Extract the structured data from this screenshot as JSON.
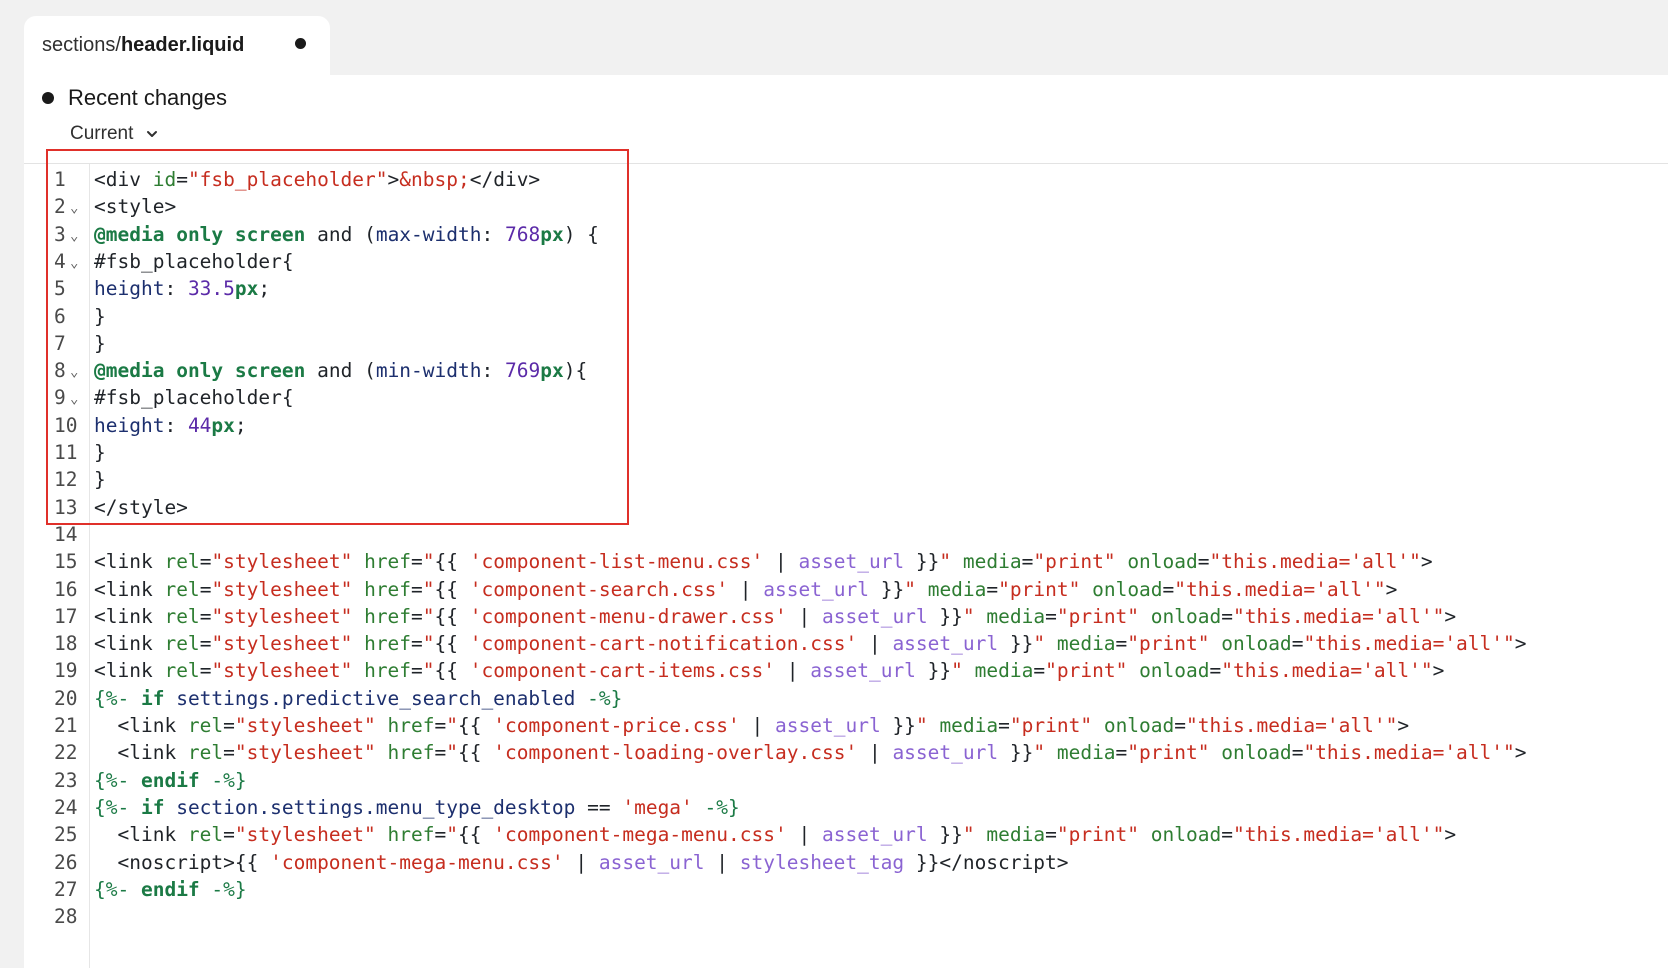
{
  "tab": {
    "path_prefix": "sections/",
    "file_name": "header.liquid"
  },
  "panel": {
    "title": "Recent changes",
    "version": "Current"
  },
  "colors": {
    "highlight": "#e0302a",
    "string": "#c62d1f",
    "keyword": "#1b7a45",
    "number": "#5b2aa8",
    "filter": "#8a63d2"
  },
  "code": {
    "lines": [
      {
        "n": "1",
        "fold": false,
        "tokens": [
          [
            "plain",
            "<div "
          ],
          [
            "attr",
            "id"
          ],
          [
            "plain",
            "="
          ],
          [
            "str",
            "\"fsb_placeholder\""
          ],
          [
            "plain",
            ">"
          ],
          [
            "str",
            "&nbsp;"
          ],
          [
            "plain",
            "</div>"
          ]
        ]
      },
      {
        "n": "2",
        "fold": true,
        "tokens": [
          [
            "plain",
            "<style>"
          ]
        ]
      },
      {
        "n": "3",
        "fold": true,
        "tokens": [
          [
            "kw",
            "@media"
          ],
          [
            "plain",
            " "
          ],
          [
            "kw",
            "only"
          ],
          [
            "plain",
            " "
          ],
          [
            "kw",
            "screen"
          ],
          [
            "plain",
            " and ("
          ],
          [
            "prop",
            "max-width"
          ],
          [
            "plain",
            ": "
          ],
          [
            "num",
            "768"
          ],
          [
            "unit",
            "px"
          ],
          [
            "plain",
            ") {"
          ]
        ]
      },
      {
        "n": "4",
        "fold": true,
        "tokens": [
          [
            "plain",
            "#fsb_placeholder{"
          ]
        ]
      },
      {
        "n": "5",
        "fold": false,
        "tokens": [
          [
            "prop",
            "height"
          ],
          [
            "plain",
            ": "
          ],
          [
            "num",
            "33.5"
          ],
          [
            "unit",
            "px"
          ],
          [
            "plain",
            ";"
          ]
        ]
      },
      {
        "n": "6",
        "fold": false,
        "tokens": [
          [
            "plain",
            "}"
          ]
        ]
      },
      {
        "n": "7",
        "fold": false,
        "tokens": [
          [
            "plain",
            "}"
          ]
        ]
      },
      {
        "n": "8",
        "fold": true,
        "tokens": [
          [
            "kw",
            "@media"
          ],
          [
            "plain",
            " "
          ],
          [
            "kw",
            "only"
          ],
          [
            "plain",
            " "
          ],
          [
            "kw",
            "screen"
          ],
          [
            "plain",
            " and ("
          ],
          [
            "prop",
            "min-width"
          ],
          [
            "plain",
            ": "
          ],
          [
            "num",
            "769"
          ],
          [
            "unit",
            "px"
          ],
          [
            "plain",
            "){"
          ]
        ]
      },
      {
        "n": "9",
        "fold": true,
        "tokens": [
          [
            "plain",
            "#fsb_placeholder{"
          ]
        ]
      },
      {
        "n": "10",
        "fold": false,
        "tokens": [
          [
            "prop",
            "height"
          ],
          [
            "plain",
            ": "
          ],
          [
            "num",
            "44"
          ],
          [
            "unit",
            "px"
          ],
          [
            "plain",
            ";"
          ]
        ]
      },
      {
        "n": "11",
        "fold": false,
        "tokens": [
          [
            "plain",
            "}"
          ]
        ]
      },
      {
        "n": "12",
        "fold": false,
        "tokens": [
          [
            "plain",
            "}"
          ]
        ]
      },
      {
        "n": "13",
        "fold": false,
        "tokens": [
          [
            "plain",
            "</style>"
          ]
        ]
      },
      {
        "n": "14",
        "fold": false,
        "tokens": []
      },
      {
        "n": "15",
        "fold": false,
        "tokens": [
          [
            "plain",
            "<link "
          ],
          [
            "attr",
            "rel"
          ],
          [
            "plain",
            "="
          ],
          [
            "str",
            "\"stylesheet\""
          ],
          [
            "plain",
            " "
          ],
          [
            "attr",
            "href"
          ],
          [
            "plain",
            "="
          ],
          [
            "str",
            "\""
          ],
          [
            "plain",
            "{{ "
          ],
          [
            "str",
            "'component-list-menu.css'"
          ],
          [
            "plain",
            " | "
          ],
          [
            "filter",
            "asset_url"
          ],
          [
            "plain",
            " }}"
          ],
          [
            "str",
            "\""
          ],
          [
            "plain",
            " "
          ],
          [
            "attr",
            "media"
          ],
          [
            "plain",
            "="
          ],
          [
            "str",
            "\"print\""
          ],
          [
            "plain",
            " "
          ],
          [
            "attr",
            "onload"
          ],
          [
            "plain",
            "="
          ],
          [
            "str",
            "\"this.media='all'\""
          ],
          [
            "plain",
            ">"
          ]
        ]
      },
      {
        "n": "16",
        "fold": false,
        "tokens": [
          [
            "plain",
            "<link "
          ],
          [
            "attr",
            "rel"
          ],
          [
            "plain",
            "="
          ],
          [
            "str",
            "\"stylesheet\""
          ],
          [
            "plain",
            " "
          ],
          [
            "attr",
            "href"
          ],
          [
            "plain",
            "="
          ],
          [
            "str",
            "\""
          ],
          [
            "plain",
            "{{ "
          ],
          [
            "str",
            "'component-search.css'"
          ],
          [
            "plain",
            " | "
          ],
          [
            "filter",
            "asset_url"
          ],
          [
            "plain",
            " }}"
          ],
          [
            "str",
            "\""
          ],
          [
            "plain",
            " "
          ],
          [
            "attr",
            "media"
          ],
          [
            "plain",
            "="
          ],
          [
            "str",
            "\"print\""
          ],
          [
            "plain",
            " "
          ],
          [
            "attr",
            "onload"
          ],
          [
            "plain",
            "="
          ],
          [
            "str",
            "\"this.media='all'\""
          ],
          [
            "plain",
            ">"
          ]
        ]
      },
      {
        "n": "17",
        "fold": false,
        "tokens": [
          [
            "plain",
            "<link "
          ],
          [
            "attr",
            "rel"
          ],
          [
            "plain",
            "="
          ],
          [
            "str",
            "\"stylesheet\""
          ],
          [
            "plain",
            " "
          ],
          [
            "attr",
            "href"
          ],
          [
            "plain",
            "="
          ],
          [
            "str",
            "\""
          ],
          [
            "plain",
            "{{ "
          ],
          [
            "str",
            "'component-menu-drawer.css'"
          ],
          [
            "plain",
            " | "
          ],
          [
            "filter",
            "asset_url"
          ],
          [
            "plain",
            " }}"
          ],
          [
            "str",
            "\""
          ],
          [
            "plain",
            " "
          ],
          [
            "attr",
            "media"
          ],
          [
            "plain",
            "="
          ],
          [
            "str",
            "\"print\""
          ],
          [
            "plain",
            " "
          ],
          [
            "attr",
            "onload"
          ],
          [
            "plain",
            "="
          ],
          [
            "str",
            "\"this.media='all'\""
          ],
          [
            "plain",
            ">"
          ]
        ]
      },
      {
        "n": "18",
        "fold": false,
        "tokens": [
          [
            "plain",
            "<link "
          ],
          [
            "attr",
            "rel"
          ],
          [
            "plain",
            "="
          ],
          [
            "str",
            "\"stylesheet\""
          ],
          [
            "plain",
            " "
          ],
          [
            "attr",
            "href"
          ],
          [
            "plain",
            "="
          ],
          [
            "str",
            "\""
          ],
          [
            "plain",
            "{{ "
          ],
          [
            "str",
            "'component-cart-notification.css'"
          ],
          [
            "plain",
            " | "
          ],
          [
            "filter",
            "asset_url"
          ],
          [
            "plain",
            " }}"
          ],
          [
            "str",
            "\""
          ],
          [
            "plain",
            " "
          ],
          [
            "attr",
            "media"
          ],
          [
            "plain",
            "="
          ],
          [
            "str",
            "\"print\""
          ],
          [
            "plain",
            " "
          ],
          [
            "attr",
            "onload"
          ],
          [
            "plain",
            "="
          ],
          [
            "str",
            "\"this.media='all'\""
          ],
          [
            "plain",
            ">"
          ]
        ]
      },
      {
        "n": "19",
        "fold": false,
        "tokens": [
          [
            "plain",
            "<link "
          ],
          [
            "attr",
            "rel"
          ],
          [
            "plain",
            "="
          ],
          [
            "str",
            "\"stylesheet\""
          ],
          [
            "plain",
            " "
          ],
          [
            "attr",
            "href"
          ],
          [
            "plain",
            "="
          ],
          [
            "str",
            "\""
          ],
          [
            "plain",
            "{{ "
          ],
          [
            "str",
            "'component-cart-items.css'"
          ],
          [
            "plain",
            " | "
          ],
          [
            "filter",
            "asset_url"
          ],
          [
            "plain",
            " }}"
          ],
          [
            "str",
            "\""
          ],
          [
            "plain",
            " "
          ],
          [
            "attr",
            "media"
          ],
          [
            "plain",
            "="
          ],
          [
            "str",
            "\"print\""
          ],
          [
            "plain",
            " "
          ],
          [
            "attr",
            "onload"
          ],
          [
            "plain",
            "="
          ],
          [
            "str",
            "\"this.media='all'\""
          ],
          [
            "plain",
            ">"
          ]
        ]
      },
      {
        "n": "20",
        "fold": false,
        "tokens": [
          [
            "liq",
            "{%- "
          ],
          [
            "kw",
            "if"
          ],
          [
            "plain",
            " "
          ],
          [
            "var",
            "settings.predictive_search_enabled"
          ],
          [
            "liq",
            " -%}"
          ]
        ]
      },
      {
        "n": "21",
        "fold": false,
        "tokens": [
          [
            "plain",
            "  <link "
          ],
          [
            "attr",
            "rel"
          ],
          [
            "plain",
            "="
          ],
          [
            "str",
            "\"stylesheet\""
          ],
          [
            "plain",
            " "
          ],
          [
            "attr",
            "href"
          ],
          [
            "plain",
            "="
          ],
          [
            "str",
            "\""
          ],
          [
            "plain",
            "{{ "
          ],
          [
            "str",
            "'component-price.css'"
          ],
          [
            "plain",
            " | "
          ],
          [
            "filter",
            "asset_url"
          ],
          [
            "plain",
            " }}"
          ],
          [
            "str",
            "\""
          ],
          [
            "plain",
            " "
          ],
          [
            "attr",
            "media"
          ],
          [
            "plain",
            "="
          ],
          [
            "str",
            "\"print\""
          ],
          [
            "plain",
            " "
          ],
          [
            "attr",
            "onload"
          ],
          [
            "plain",
            "="
          ],
          [
            "str",
            "\"this.media='all'\""
          ],
          [
            "plain",
            ">"
          ]
        ]
      },
      {
        "n": "22",
        "fold": false,
        "tokens": [
          [
            "plain",
            "  <link "
          ],
          [
            "attr",
            "rel"
          ],
          [
            "plain",
            "="
          ],
          [
            "str",
            "\"stylesheet\""
          ],
          [
            "plain",
            " "
          ],
          [
            "attr",
            "href"
          ],
          [
            "plain",
            "="
          ],
          [
            "str",
            "\""
          ],
          [
            "plain",
            "{{ "
          ],
          [
            "str",
            "'component-loading-overlay.css'"
          ],
          [
            "plain",
            " | "
          ],
          [
            "filter",
            "asset_url"
          ],
          [
            "plain",
            " }}"
          ],
          [
            "str",
            "\""
          ],
          [
            "plain",
            " "
          ],
          [
            "attr",
            "media"
          ],
          [
            "plain",
            "="
          ],
          [
            "str",
            "\"print\""
          ],
          [
            "plain",
            " "
          ],
          [
            "attr",
            "onload"
          ],
          [
            "plain",
            "="
          ],
          [
            "str",
            "\"this.media='all'\""
          ],
          [
            "plain",
            ">"
          ]
        ]
      },
      {
        "n": "23",
        "fold": false,
        "tokens": [
          [
            "liq",
            "{%- "
          ],
          [
            "kw",
            "endif"
          ],
          [
            "liq",
            " -%}"
          ]
        ]
      },
      {
        "n": "24",
        "fold": false,
        "tokens": [
          [
            "liq",
            "{%- "
          ],
          [
            "kw",
            "if"
          ],
          [
            "plain",
            " "
          ],
          [
            "var",
            "section.settings.menu_type_desktop"
          ],
          [
            "plain",
            " == "
          ],
          [
            "str",
            "'mega'"
          ],
          [
            "liq",
            " -%}"
          ]
        ]
      },
      {
        "n": "25",
        "fold": false,
        "tokens": [
          [
            "plain",
            "  <link "
          ],
          [
            "attr",
            "rel"
          ],
          [
            "plain",
            "="
          ],
          [
            "str",
            "\"stylesheet\""
          ],
          [
            "plain",
            " "
          ],
          [
            "attr",
            "href"
          ],
          [
            "plain",
            "="
          ],
          [
            "str",
            "\""
          ],
          [
            "plain",
            "{{ "
          ],
          [
            "str",
            "'component-mega-menu.css'"
          ],
          [
            "plain",
            " | "
          ],
          [
            "filter",
            "asset_url"
          ],
          [
            "plain",
            " }}"
          ],
          [
            "str",
            "\""
          ],
          [
            "plain",
            " "
          ],
          [
            "attr",
            "media"
          ],
          [
            "plain",
            "="
          ],
          [
            "str",
            "\"print\""
          ],
          [
            "plain",
            " "
          ],
          [
            "attr",
            "onload"
          ],
          [
            "plain",
            "="
          ],
          [
            "str",
            "\"this.media='all'\""
          ],
          [
            "plain",
            ">"
          ]
        ]
      },
      {
        "n": "26",
        "fold": false,
        "tokens": [
          [
            "plain",
            "  <noscript>{{ "
          ],
          [
            "str",
            "'component-mega-menu.css'"
          ],
          [
            "plain",
            " | "
          ],
          [
            "filter",
            "asset_url"
          ],
          [
            "plain",
            " | "
          ],
          [
            "filter",
            "stylesheet_tag"
          ],
          [
            "plain",
            " }}</noscript>"
          ]
        ]
      },
      {
        "n": "27",
        "fold": false,
        "tokens": [
          [
            "liq",
            "{%- "
          ],
          [
            "kw",
            "endif"
          ],
          [
            "liq",
            " -%}"
          ]
        ]
      },
      {
        "n": "28",
        "fold": false,
        "tokens": []
      }
    ]
  }
}
